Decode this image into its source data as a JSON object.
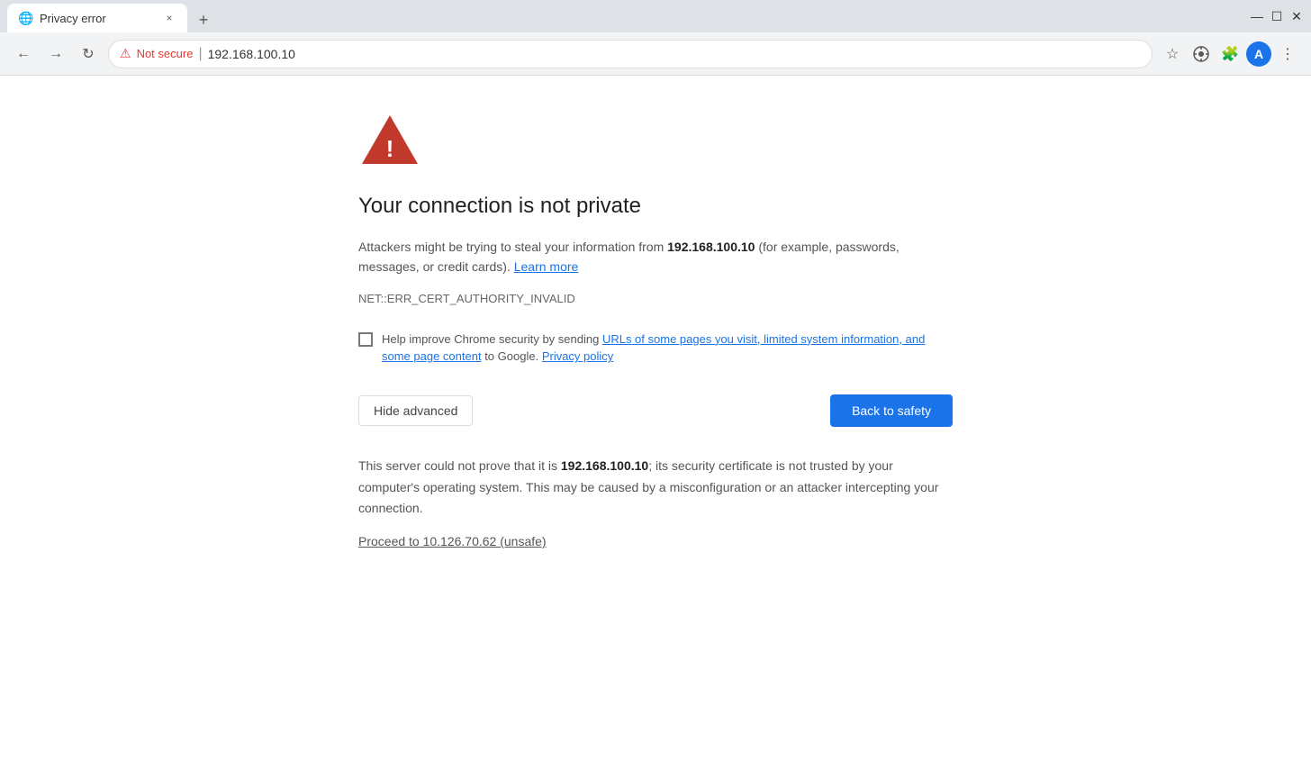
{
  "browser": {
    "tab": {
      "favicon": "🌐",
      "title": "Privacy error",
      "close": "×"
    },
    "new_tab": "+",
    "window_controls": {
      "minimize": "—",
      "maximize": "☐",
      "close": "✕"
    },
    "nav": {
      "back": "←",
      "forward": "→",
      "reload": "↻"
    },
    "address": {
      "not_secure_icon": "⚠",
      "not_secure_text": "Not secure",
      "divider": "|",
      "url": "192.168.100.10"
    },
    "toolbar": {
      "star": "☆",
      "extensions": "🔧",
      "more": "⋮",
      "user_avatar": "A"
    }
  },
  "page": {
    "error_code": "NET::ERR_CERT_AUTHORITY_INVALID",
    "title": "Your connection is not private",
    "description_before": "Attackers might be trying to steal your information from ",
    "ip_address": "192.168.100.10",
    "description_after": " (for example, passwords, messages, or credit cards).",
    "learn_more": "Learn more",
    "checkbox_before": "Help improve Chrome security by sending ",
    "checkbox_link": "URLs of some pages you visit, limited system information, and some page content",
    "checkbox_after": " to Google.",
    "privacy_policy": "Privacy policy",
    "hide_advanced_label": "Hide advanced",
    "back_to_safety_label": "Back to safety",
    "advanced_text_before": "This server could not prove that it is ",
    "advanced_ip": "192.168.100.10",
    "advanced_text_after": "; its security certificate is not trusted by your computer's operating system. This may be caused by a misconfiguration or an attacker intercepting your connection.",
    "proceed_link": "Proceed to 10.126.70.62 (unsafe)"
  }
}
